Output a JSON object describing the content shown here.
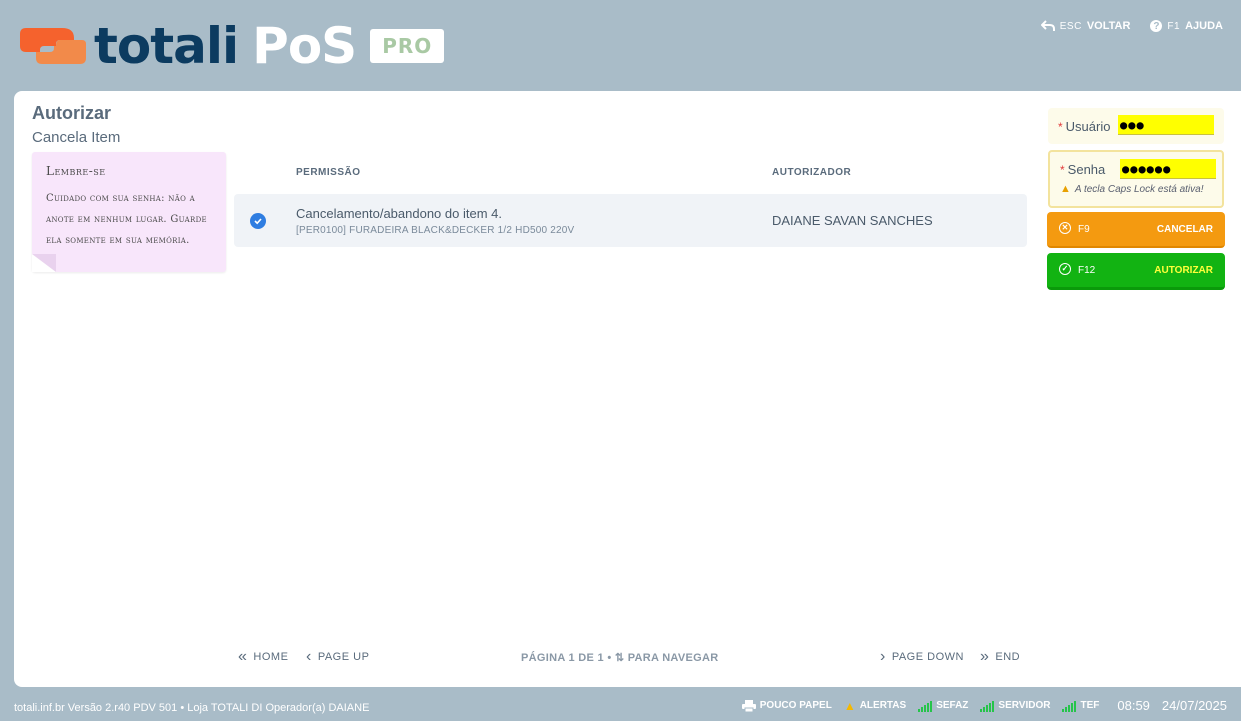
{
  "header": {
    "logo_word_1": "totali",
    "logo_word_2": "PoS",
    "badge": "PRO",
    "back_key": "ESC",
    "back_label": "VOLTAR",
    "help_key": "F1",
    "help_label": "AJUDA"
  },
  "page": {
    "title": "Autorizar",
    "subtitle": "Cancela Item"
  },
  "note": {
    "title": "Lembre-se",
    "text": "Cuidado com sua senha: não a anote em nenhum lugar. Guarde ela somente em sua memória."
  },
  "table": {
    "columns": [
      "PERMISSÃO",
      "AUTORIZADOR"
    ],
    "rows": [
      {
        "checked": true,
        "title": "Cancelamento/abandono do item 4.",
        "detail": "[PER0100] FURADEIRA BLACK&DECKER 1/2 HD500 220V",
        "authorizer": "DAIANE SAVAN SANCHES"
      }
    ]
  },
  "pager": {
    "home": "HOME",
    "page_up": "PAGE UP",
    "info": "PÁGINA  1  DE  1  •  ⇅  PARA NAVEGAR",
    "page_down": "PAGE DOWN",
    "end": "END"
  },
  "form": {
    "user_label": "Usuário",
    "user_value": "●●●",
    "pass_label": "Senha",
    "pass_value": "●●●●●●",
    "caps_warning": "A tecla Caps Lock está ativa!",
    "cancel_key": "F9",
    "cancel_label": "CANCELAR",
    "auth_key": "F12",
    "auth_label": "AUTORIZAR"
  },
  "footer": {
    "info": "totali.inf.br  Versão 2.r40  PDV 501   •   Loja TOTALI DI  Operador(a) DAIANE",
    "paper": "POUCO PAPEL",
    "alerts": "ALERTAS",
    "sefaz": "SEFAZ",
    "server": "SERVIDOR",
    "tef": "TEF",
    "time": "08:59",
    "date": "24/07/2025"
  },
  "colors": {
    "background": "#a9bcc8",
    "brand_dark": "#0c3b60",
    "brand_orange": "#f5622d",
    "cancel": "#f49a10",
    "authorize": "#12b312",
    "input_highlight": "#ffff00",
    "note_bg": "#f8e6fb",
    "status_ok": "#25c44a"
  }
}
